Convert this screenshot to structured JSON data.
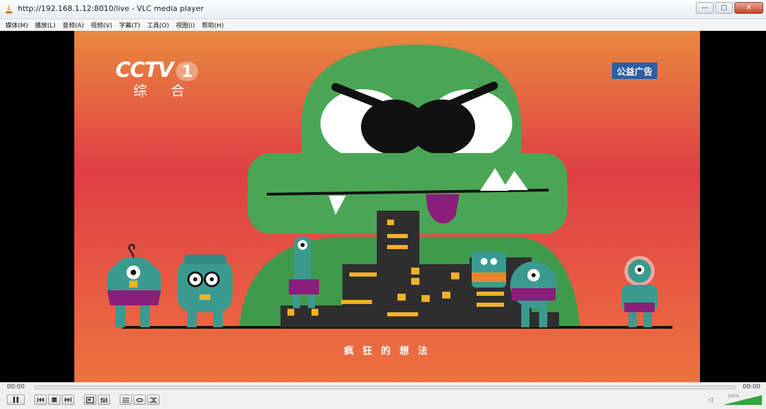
{
  "window": {
    "title": "http://192.168.1.12:8010/live - VLC media player",
    "buttons": {
      "minimize": "—",
      "maximize": "▢",
      "close": "✕"
    }
  },
  "menu": {
    "items": [
      {
        "label": "媒体(M)"
      },
      {
        "label": "播放(L)"
      },
      {
        "label": "音频(A)"
      },
      {
        "label": "视频(V)"
      },
      {
        "label": "字幕(T)"
      },
      {
        "label": "工具(O)"
      },
      {
        "label": "视图(I)"
      },
      {
        "label": "帮助(H)"
      }
    ]
  },
  "video": {
    "channel_logo": "CCTV",
    "channel_number": "1",
    "channel_name": "综 合",
    "badge": "公益广告",
    "subtitle": "疯 狂 的 想 法",
    "colors": {
      "bg_top": "#e9893f",
      "bg_mid": "#df3e45",
      "bg_bottom": "#ec7340",
      "monster": "#4aa655",
      "building": "#2e2e2e",
      "window_light": "#f2b12a"
    }
  },
  "playback": {
    "elapsed": "00:00",
    "total": "00:00",
    "progress": 0
  },
  "controls": {
    "icons": [
      "pause-icon",
      "previous-icon",
      "stop-icon",
      "next-icon",
      "fullscreen-icon",
      "extended-settings-icon",
      "playlist-icon",
      "loop-icon",
      "shuffle-icon"
    ]
  },
  "volume": {
    "percent_label": "100%",
    "level": 1.0,
    "accent": "#2fa83a"
  }
}
